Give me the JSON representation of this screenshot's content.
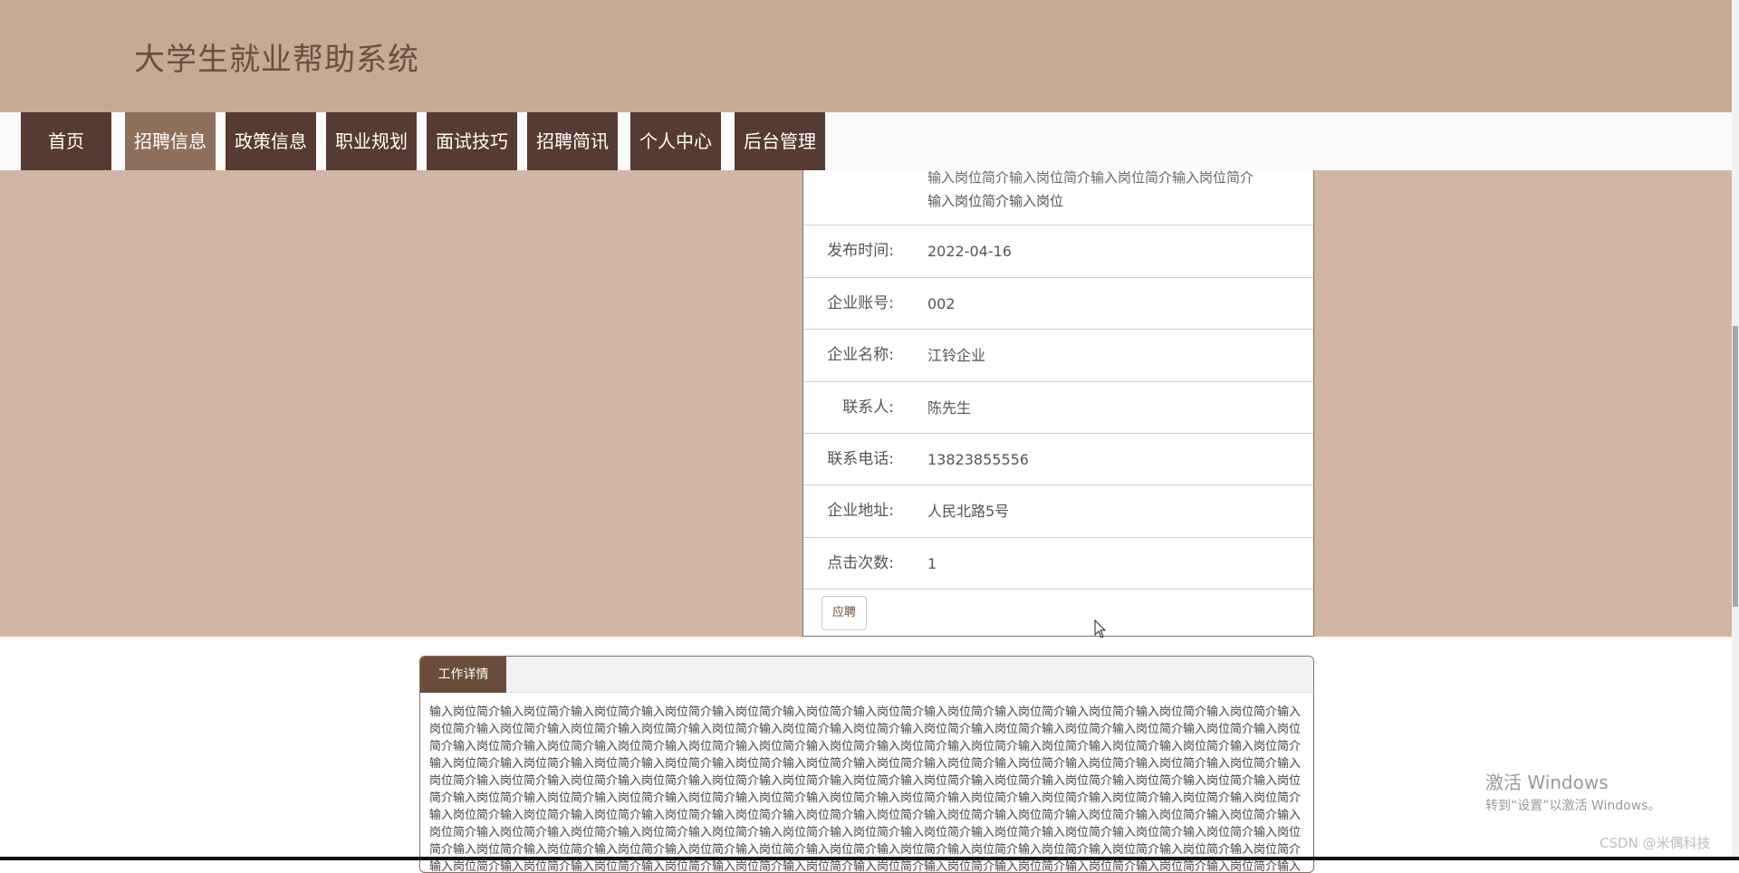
{
  "site": {
    "title": "大学生就业帮助系统"
  },
  "nav": {
    "items": [
      {
        "label": "首页"
      },
      {
        "label": "招聘信息"
      },
      {
        "label": "政策信息"
      },
      {
        "label": "职业规划"
      },
      {
        "label": "面试技巧"
      },
      {
        "label": "招聘简讯"
      },
      {
        "label": "个人中心"
      },
      {
        "label": "后台管理"
      }
    ],
    "active_index": 1
  },
  "detail": {
    "description_clipped": "输入岗位简介输入岗位简介输入岗位简介输入岗位简介",
    "description_last": "输入岗位简介输入岗位",
    "fields": [
      {
        "label": "发布时间:",
        "value": "2022-04-16"
      },
      {
        "label": "企业账号:",
        "value": "002"
      },
      {
        "label": "企业名称:",
        "value": "江铃企业"
      },
      {
        "label": "联系人:",
        "value": "陈先生"
      },
      {
        "label": "联系电话:",
        "value": "13823855556"
      },
      {
        "label": "企业地址:",
        "value": "人民北路5号"
      },
      {
        "label": "点击次数:",
        "value": "1"
      }
    ],
    "apply_label": "应聘"
  },
  "job_panel": {
    "tab_label": "工作详情",
    "content": "输入岗位简介输入岗位简介输入岗位简介输入岗位简介输入岗位简介输入岗位简介输入岗位简介输入岗位简介输入岗位简介输入岗位简介输入岗位简介输入岗位简介输入岗位简介输入岗位简介输入岗位简介输入岗位简介输入岗位简介输入岗位简介输入岗位简介输入岗位简介输入岗位简介输入岗位简介输入岗位简介输入岗位简介输入岗位简介输入岗位简介输入岗位简介输入岗位简介输入岗位简介输入岗位简介输入岗位简介输入岗位简介输入岗位简介输入岗位简介输入岗位简介输入岗位简介输入岗位简介输入岗位简介输入岗位简介输入岗位简介输入岗位简介输入岗位简介输入岗位简介输入岗位简介输入岗位简介输入岗位简介输入岗位简介输入岗位简介输入岗位简介输入岗位简介输入岗位简介输入岗位简介输入岗位简介输入岗位简介输入岗位简介输入岗位简介输入岗位简介输入岗位简介输入岗位简介输入岗位简介输入岗位简介输入岗位简介输入岗位简介输入岗位简介输入岗位简介输入岗位简介输入岗位简介输入岗位简介输入岗位简介输入岗位简介输入岗位简介输入岗位简介输入岗位简介输入岗位简介输入岗位简介输入岗位简介输入岗位简介输入岗位简介输入岗位简介输入岗位简介输入岗位简介输入岗位简介输入岗位简介输入岗位简介输入岗位简介输入岗位简介输入岗位简介输入岗位简介输入岗位简介输入岗位简介输入岗位简介输入岗位简介输入岗位简介输入岗位简介输入岗位简介输入岗位简介输入岗位简介输入岗位简介输入岗位简介输入岗位简介输入岗位简介输入岗位简介输入岗位简介输入岗位简介输入岗位简介输入岗位简介输入岗位简介输入岗位简介输入岗位简介输入岗位简介输入岗位简介输入岗位简介输入岗位简介输入岗位简介输入岗位简介输入岗位简介输入岗位简介输入岗位简介输入岗位简介输入岗位简介输入岗位简介输入岗位简介输入岗位简介输入岗位简介输入岗位简介输入岗位简介输入岗位简介输入岗位简介输入岗位简介输入岗位简介输入岗位简介输入岗位简介输入岗位简介输入岗位简介输入岗位简介输入岗位"
  },
  "watermark": {
    "line1": "激活 Windows",
    "line2": "转到“设置”以激活 Windows。"
  },
  "credit": "CSDN @米偶科技",
  "colors": {
    "header_bg": "#c5aa94",
    "nav_item": "#553b31",
    "nav_active": "#8d6f5b",
    "hero_bg": "#d1b6a5"
  }
}
